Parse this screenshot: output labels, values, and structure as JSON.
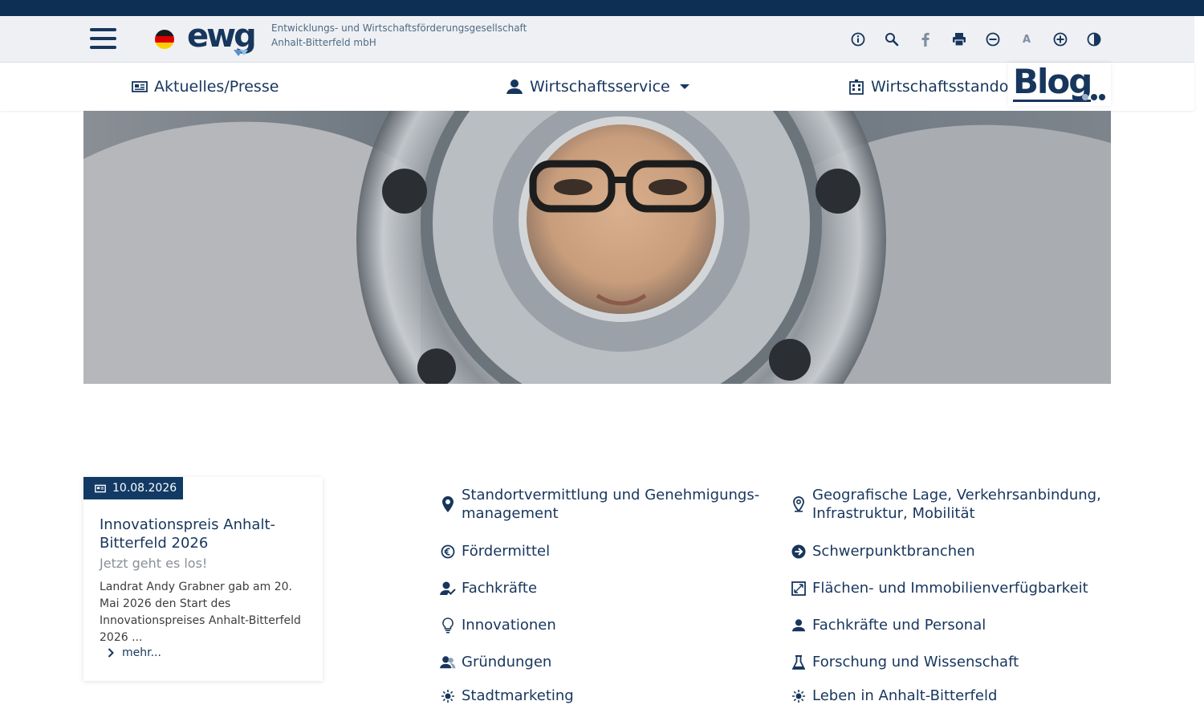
{
  "header": {
    "logo": {
      "wordmark": "ewg",
      "line1": "Entwicklungs- und Wirtschaftsförderungsgesellschaft",
      "line2": "Anhalt-Bitterfeld mbH"
    },
    "tool_letter": "A"
  },
  "nav": {
    "items": [
      {
        "label": "Aktuelles/Presse"
      },
      {
        "label": "Wirtschaftsservice"
      },
      {
        "label": "Wirtschaftsstandort"
      }
    ],
    "blog_label": "Blog"
  },
  "news": {
    "date": "10.08.2026",
    "title": "Innovationspreis Anhalt-Bitterfeld 2026",
    "subtitle": "Jetzt geht es los!",
    "text": "Landrat Andy Grabner gab am 20. Mai 2026 den Start des Innovationspreises Anhalt-Bitterfeld 2026 ...",
    "more": "mehr..."
  },
  "links_left": [
    {
      "line1": "Standortvermittlung und Genehmigungs-",
      "line2": "management"
    },
    {
      "line1": "Fördermittel"
    },
    {
      "line1": "Fachkräfte"
    },
    {
      "line1": "Innovationen"
    },
    {
      "line1": "Gründungen"
    },
    {
      "line1": "Stadtmarketing"
    }
  ],
  "links_right": [
    {
      "line1": "Geografische Lage, Verkehrsanbindung,",
      "line2": "Infrastruktur, Mobilität"
    },
    {
      "line1": "Schwerpunktbranchen"
    },
    {
      "line1": "Flächen- und Immobilienverfügbarkeit"
    },
    {
      "line1": "Fachkräfte und Personal"
    },
    {
      "line1": "Forschung und Wissenschaft"
    },
    {
      "line1": "Leben in Anhalt-Bitterfeld"
    }
  ],
  "colors": {
    "primary": "#17365d",
    "top_strip": "#0e2f54",
    "badge": "#123a65",
    "header_bg": "#eef0f3"
  }
}
